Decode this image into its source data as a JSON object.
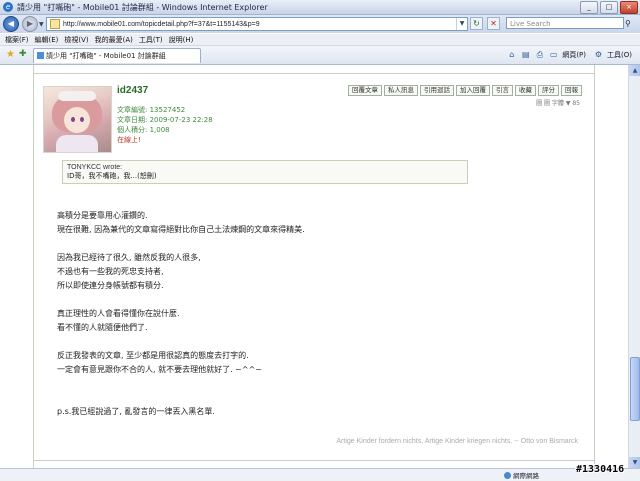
{
  "window": {
    "title": "請少用 \"打嘴砲\" - Mobile01 討論群組 - Windows Internet Explorer",
    "controls": [
      "_",
      "□",
      "×"
    ]
  },
  "address_bar": {
    "url": "http://www.mobile01.com/topicdetail.php?f=37&t=1155143&p=9",
    "search_placeholder": "Live Search"
  },
  "menu": [
    "檔案(F)",
    "編輯(E)",
    "檢視(V)",
    "我的最愛(A)",
    "工具(T)",
    "說明(H)"
  ],
  "tab": {
    "label": "請少用 \"打嘴砲\" - Mobile01 討論群組"
  },
  "toolbar": {
    "page_label": "網頁(P)",
    "tools_label": "工具(O)"
  },
  "post": {
    "username": "id2437",
    "meta": {
      "posts_label": "文章編號:",
      "posts_value": "13527452",
      "date_label": "文章日期:",
      "date_value": "2009-07-23 22:28",
      "points_label": "個人積分:",
      "points_value": "1,008",
      "online": "在線上!"
    },
    "actions": [
      "回覆文章",
      "私人訊息",
      "引用迴話",
      "加入回覆",
      "引言",
      "收藏",
      "評分",
      "回報"
    ],
    "font_size": "圖 圖 字體 ▼ 85",
    "quote": {
      "author": "TONYKCC wrote:",
      "text": "ID哥，我不嘴砲，我...(恕刪)"
    },
    "body": [
      [
        "高積分是要靠用心灌鑽的.",
        "現在很難, 因為兼代的文章寫得絕對比你自己土法煉鋼的文章來得精美."
      ],
      [
        "因為我已經待了很久, 雖然反我的人很多,",
        "不過也有一些我的死忠支持者,",
        "所以即使連分身帳號都有積分."
      ],
      [
        "真正理性的人會看得懂你在說什麼.",
        "看不懂的人就隨便他們了."
      ],
      [
        "反正我發表的文章, 至少都是用很認真的態度去打字的.",
        "一定會有意見跟你不合的人, 就不要去理他就好了. ~^^~"
      ],
      [
        "p.s.我已經說過了, 亂發言的一律丟入黑名單."
      ]
    ],
    "signature": "Artige Kinder fordern nichts. Artige Kinder kriegen nichts. -- Otto von Bismarck"
  },
  "status": {
    "zone": "網際網路"
  },
  "watermark": "#1330416"
}
